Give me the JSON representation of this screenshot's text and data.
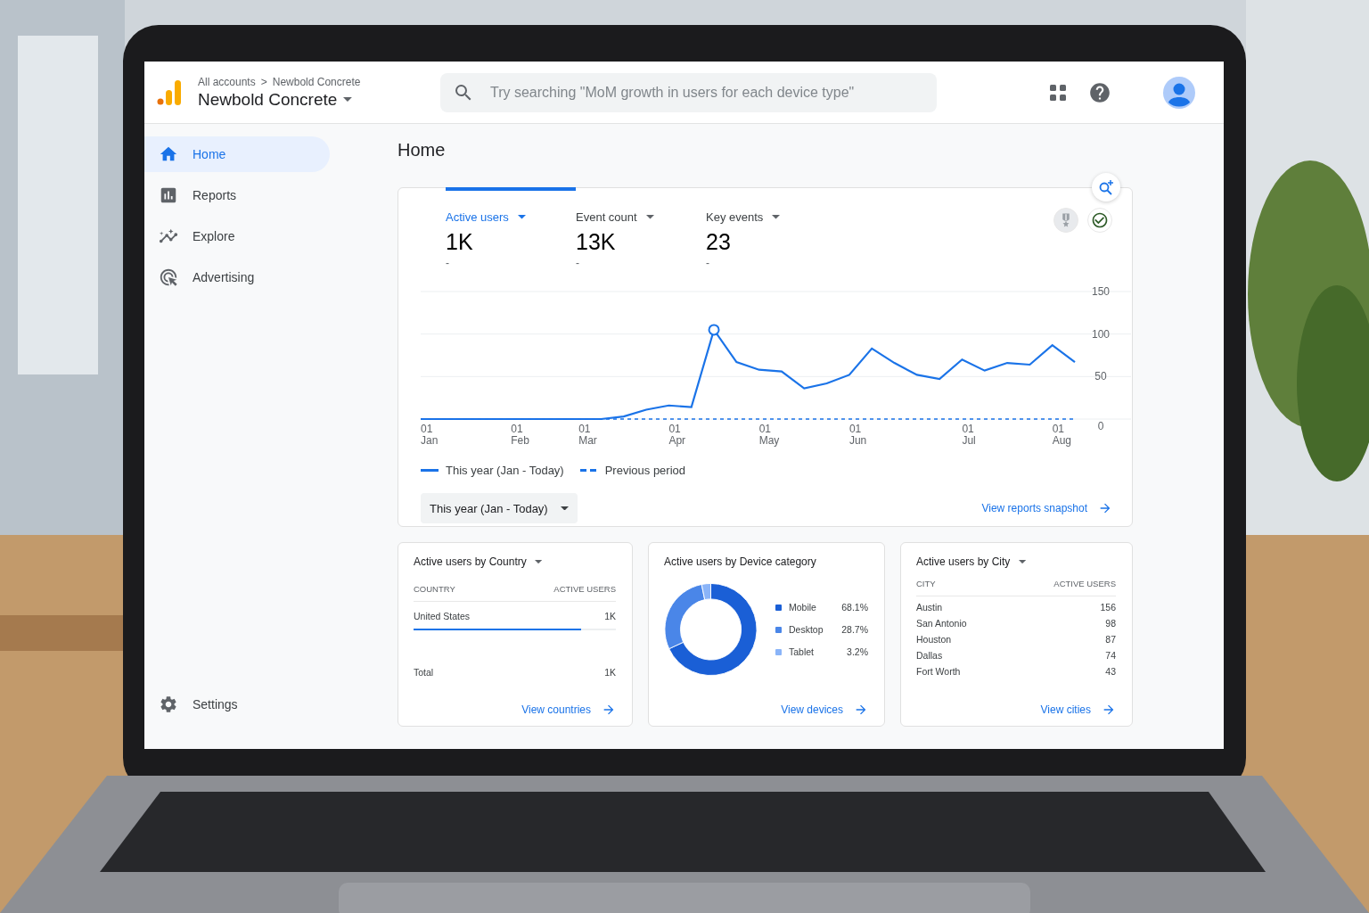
{
  "header": {
    "breadcrumb": [
      "All accounts",
      "Newbold Concrete"
    ],
    "breadcrumb_separator": ">",
    "property": "Newbold Concrete",
    "search": {
      "placeholder": "Try searching \"MoM growth in users for each device type\""
    }
  },
  "sidebar": {
    "items": [
      {
        "label": "Home",
        "kind": "home",
        "selected": true
      },
      {
        "label": "Reports",
        "kind": "reports",
        "selected": false
      },
      {
        "label": "Explore",
        "kind": "explore",
        "selected": false
      },
      {
        "label": "Advertising",
        "kind": "advertising",
        "selected": false
      }
    ],
    "footer": {
      "label": "Settings"
    }
  },
  "page_title": "Home",
  "overview": {
    "metrics": [
      {
        "label": "Active users",
        "value": "1K",
        "change": "-",
        "selected": true
      },
      {
        "label": "Event count",
        "value": "13K",
        "change": "-",
        "selected": false
      },
      {
        "label": "Key events",
        "value": "23",
        "change": "-",
        "selected": false
      }
    ],
    "chart_data": {
      "type": "line",
      "categories": [
        "01 Jan",
        null,
        null,
        null,
        "01 Feb",
        null,
        null,
        "01 Mar",
        null,
        null,
        null,
        "01 Apr",
        null,
        null,
        null,
        "01 May",
        null,
        null,
        null,
        "01 Jun",
        null,
        null,
        null,
        null,
        "01 Jul",
        null,
        null,
        null,
        "01 Aug",
        null
      ],
      "series": [
        {
          "name": "This year (Jan - Today)",
          "color": "#1a73e8",
          "line_style": "solid",
          "values": [
            0,
            0,
            0,
            0,
            0,
            0,
            0,
            0,
            0,
            3,
            11,
            16,
            14,
            105,
            67,
            58,
            56,
            36,
            42,
            52,
            83,
            66,
            52,
            47,
            70,
            57,
            66,
            64,
            87,
            67
          ]
        },
        {
          "name": "Previous period",
          "color": "#1a73e8",
          "line_style": "dashed",
          "values": [
            0,
            0,
            0,
            0,
            0,
            0,
            0,
            0,
            0,
            0,
            0,
            0,
            0,
            0,
            0,
            0,
            0,
            0,
            0,
            0,
            0,
            0,
            0,
            0,
            0,
            0,
            0,
            0,
            0,
            0
          ]
        }
      ],
      "ylim": [
        0,
        150
      ],
      "yticks": [
        0,
        50,
        100,
        150
      ]
    },
    "date_range": "This year (Jan - Today)",
    "link": "View reports snapshot"
  },
  "country_card": {
    "title": "Active users by Country",
    "columns": [
      "COUNTRY",
      "ACTIVE USERS"
    ],
    "rows": [
      {
        "name": "United States",
        "value": "1K",
        "level": 0.83
      }
    ],
    "total": {
      "label": "Total",
      "value": "1K"
    },
    "link": "View countries"
  },
  "device_card": {
    "title": "Active users by Device category",
    "chart_data": {
      "type": "donut",
      "categories": [
        "Mobile",
        "Desktop",
        "Tablet"
      ],
      "values": [
        68.1,
        28.7,
        3.2
      ],
      "value_labels": [
        "68.1%",
        "28.7%",
        "3.2%"
      ],
      "colors": [
        "#1a5fd6",
        "#4a86e8",
        "#8ab4f8"
      ]
    },
    "link": "View devices"
  },
  "city_card": {
    "title": "Active users by City",
    "columns": [
      "CITY",
      "ACTIVE USERS"
    ],
    "rows": [
      {
        "name": "Austin",
        "value": "156"
      },
      {
        "name": "San Antonio",
        "value": "98"
      },
      {
        "name": "Houston",
        "value": "87"
      },
      {
        "name": "Dallas",
        "value": "74"
      },
      {
        "name": "Fort Worth",
        "value": "43"
      }
    ],
    "link": "View cities"
  }
}
